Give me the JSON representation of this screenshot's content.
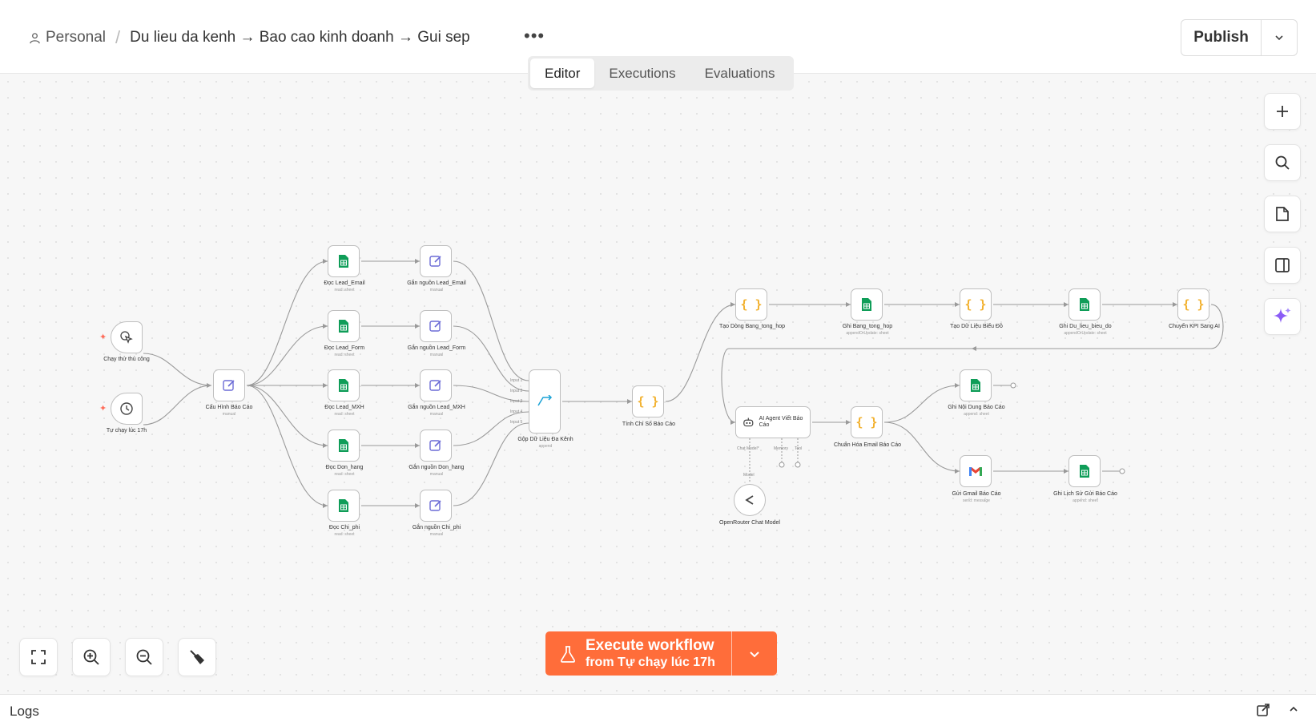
{
  "header": {
    "project": "Personal",
    "workflow_name": "Du lieu da kenh → Bao cao kinh doanh → Gui sep",
    "more_label": "•••",
    "tabs": [
      {
        "label": "Editor",
        "active": true
      },
      {
        "label": "Executions",
        "active": false
      },
      {
        "label": "Evaluations",
        "active": false
      }
    ],
    "publish_label": "Publish"
  },
  "nodes": {
    "manual_trigger": {
      "label": "Chạy thử thủ công",
      "icon": "cursor-click-icon"
    },
    "schedule_trigger": {
      "label": "Tự chạy lúc 17h",
      "icon": "clock-icon"
    },
    "config": {
      "label": "Cấu Hình Báo Cáo",
      "sub": "manual",
      "icon": "pen-icon"
    },
    "read_email": {
      "label": "Đọc Lead_Email",
      "sub": "read: sheet",
      "icon": "sheets-icon"
    },
    "read_form": {
      "label": "Đọc Lead_Form",
      "sub": "read: sheet",
      "icon": "sheets-icon"
    },
    "read_mxh": {
      "label": "Đọc Lead_MXH",
      "sub": "read: sheet",
      "icon": "sheets-icon"
    },
    "read_donhang": {
      "label": "Đọc Don_hang",
      "sub": "read: sheet",
      "icon": "sheets-icon"
    },
    "read_chiphi": {
      "label": "Đọc Chi_phi",
      "sub": "read: sheet",
      "icon": "sheets-icon"
    },
    "tag_email": {
      "label": "Gắn nguồn Lead_Email",
      "sub": "manual",
      "icon": "pen-icon"
    },
    "tag_form": {
      "label": "Gắn nguồn Lead_Form",
      "sub": "manual",
      "icon": "pen-icon"
    },
    "tag_mxh": {
      "label": "Gắn nguồn Lead_MXH",
      "sub": "manual",
      "icon": "pen-icon"
    },
    "tag_donhang": {
      "label": "Gắn nguồn Don_hang",
      "sub": "manual",
      "icon": "pen-icon"
    },
    "tag_chiphi": {
      "label": "Gắn nguồn Chi_phi",
      "sub": "manual",
      "icon": "pen-icon"
    },
    "merge": {
      "label": "Gộp Dữ Liệu Đa Kênh",
      "sub": "append",
      "icon": "merge-icon",
      "inputs": [
        "Input 1",
        "Input 2",
        "Input 3",
        "Input 4",
        "Input 5"
      ]
    },
    "metrics": {
      "label": "Tính Chỉ Số Báo Cáo",
      "icon": "code-icon"
    },
    "create_rows": {
      "label": "Tạo Dòng Bang_tong_hop",
      "icon": "code-icon"
    },
    "write_summary": {
      "label": "Ghi Bang_tong_hop",
      "sub": "appendOrUpdate: sheet",
      "icon": "sheets-icon"
    },
    "chart_data": {
      "label": "Tạo Dữ Liệu Biểu Đồ",
      "icon": "code-icon"
    },
    "write_chart": {
      "label": "Ghi Du_lieu_bieu_do",
      "sub": "appendOrUpdate: sheet",
      "icon": "sheets-icon"
    },
    "kpi_to_ai": {
      "label": "Chuyển KPI Sang AI",
      "icon": "code-icon"
    },
    "ai_agent": {
      "label": "AI Agent Viết Báo Cáo",
      "icon": "robot-icon",
      "ports": [
        "Chat Model*",
        "Memory",
        "Tool"
      ]
    },
    "openrouter": {
      "label": "OpenRouter Chat Model",
      "icon": "openrouter-icon",
      "port": "Model"
    },
    "normalize_email": {
      "label": "Chuẩn Hóa Email Báo Cáo",
      "icon": "code-icon"
    },
    "write_content": {
      "label": "Ghi Nội Dung Báo Cáo",
      "sub": "append: sheet",
      "icon": "sheets-icon"
    },
    "gmail": {
      "label": "Gửi Gmail Báo Cáo",
      "sub": "send: message",
      "icon": "gmail-icon"
    },
    "write_history": {
      "label": "Ghi Lịch Sử Gửi Báo Cáo",
      "sub": "append: sheet",
      "icon": "sheets-icon"
    }
  },
  "execute": {
    "line1": "Execute workflow",
    "line2": "from Tự chạy lúc 17h"
  },
  "logs": {
    "title": "Logs"
  },
  "colors": {
    "accent": "#ff6d3a",
    "sheets": "#0f9d58",
    "code": "#f2b12f",
    "edit": "#6b6bd6",
    "ai_sparkle": "#8b5cf6"
  }
}
